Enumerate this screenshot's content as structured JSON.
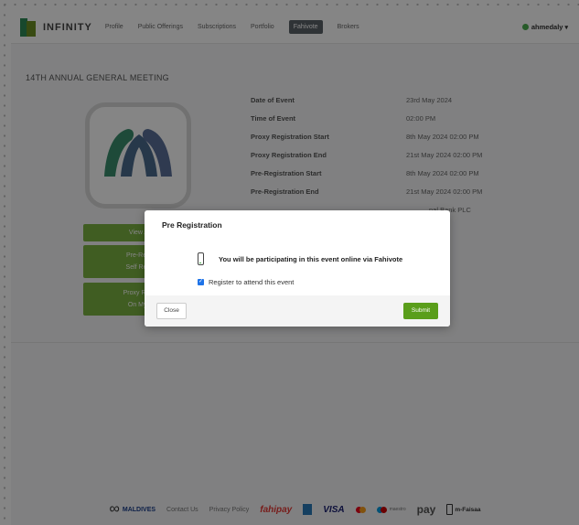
{
  "navbar": {
    "brand": "INFINITY",
    "links": [
      {
        "label": "Profile"
      },
      {
        "label": "Public Offerings"
      },
      {
        "label": "Subscriptions"
      },
      {
        "label": "Portfolio"
      },
      {
        "label": "Fahivote"
      },
      {
        "label": "Brokers"
      }
    ],
    "active_link": "Fahivote",
    "user": "ahmedaly",
    "user_status_color": "#4caf50"
  },
  "page": {
    "heading": "14TH ANNUAL GENERAL MEETING",
    "details": [
      {
        "label": "Date of Event",
        "value": "23rd May 2024"
      },
      {
        "label": "Time of Event",
        "value": "02:00 PM"
      },
      {
        "label": "Proxy Registration Start",
        "value": "8th May 2024 02:00 PM"
      },
      {
        "label": "Proxy Registration End",
        "value": "21st May 2024 02:00 PM"
      },
      {
        "label": "Pre-Registration Start",
        "value": "8th May 2024 02:00 PM"
      },
      {
        "label": "Pre-Registration End",
        "value": "21st May 2024 02:00 PM"
      }
    ],
    "partial_row": {
      "value": "nal Bank PLC"
    },
    "side_buttons": {
      "agenda": "View Ag",
      "prereg_line1": "Pre-Regis",
      "prereg_line2": "Self Regis",
      "proxy_line1": "Proxy Regis",
      "proxy_line2": "On My B"
    },
    "accent_color": "#7cb342"
  },
  "footer": {
    "maldives": "MALDIVES",
    "contact": "Contact Us",
    "privacy": "Privacy Policy",
    "fahipay": "fahipay",
    "visa": "VISA",
    "maestro": "maestro",
    "pay": "pay",
    "mfaisaa": "m-Faisaa"
  },
  "modal": {
    "title": "Pre Registration",
    "info": "You will be participating in this event online via Fahivote",
    "checkbox_label": "Register to attend this event",
    "checkbox_checked": true,
    "close_label": "Close",
    "submit_label": "Submit",
    "submit_color": "#5a9e1b"
  }
}
